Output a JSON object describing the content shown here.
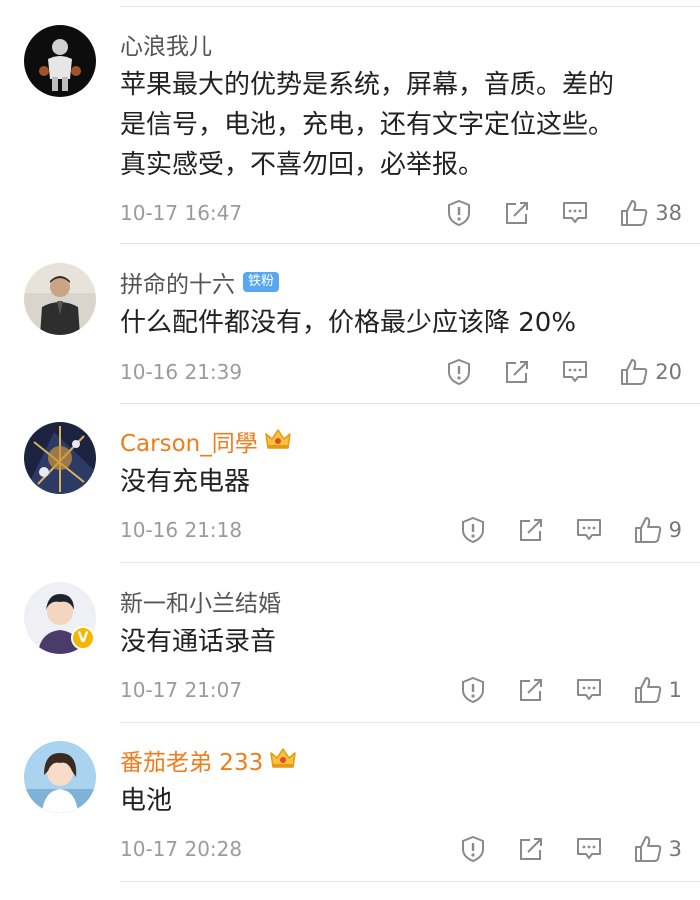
{
  "comments": [
    {
      "username": "心浪我儿",
      "text_lines": [
        "苹果最大的优势是系统，屏幕，音质。差的",
        "是信号，电池，充电，还有文字定位这些。",
        "真实感受，不喜勿回，必举报。"
      ],
      "timestamp": "10-17 16:47",
      "likes": "38"
    },
    {
      "username": "拼命的十六",
      "badge": "铁粉",
      "text_lines": [
        "什么配件都没有，价格最少应该降 20%"
      ],
      "timestamp": "10-16 21:39",
      "likes": "20"
    },
    {
      "username": "Carson_同學",
      "text_lines": [
        "没有充电器"
      ],
      "timestamp": "10-16 21:18",
      "likes": "9"
    },
    {
      "username": "新一和小兰结婚",
      "verified_mark": "V",
      "text_lines": [
        "没有通话录音"
      ],
      "timestamp": "10-17 21:07",
      "likes": "1"
    },
    {
      "username": "番茄老弟 233",
      "text_lines": [
        "电池"
      ],
      "timestamp": "10-17 20:28",
      "likes": "3"
    }
  ],
  "icons": {
    "report": "exclamation-circle-icon",
    "share": "share-box-icon",
    "reply": "comment-bubble-icon",
    "like": "thumbs-up-icon",
    "crown": "crown-icon"
  },
  "colors": {
    "vip_name": "#f17c1b",
    "fan_badge": "#58a7f0",
    "verified": "#f7b500"
  }
}
